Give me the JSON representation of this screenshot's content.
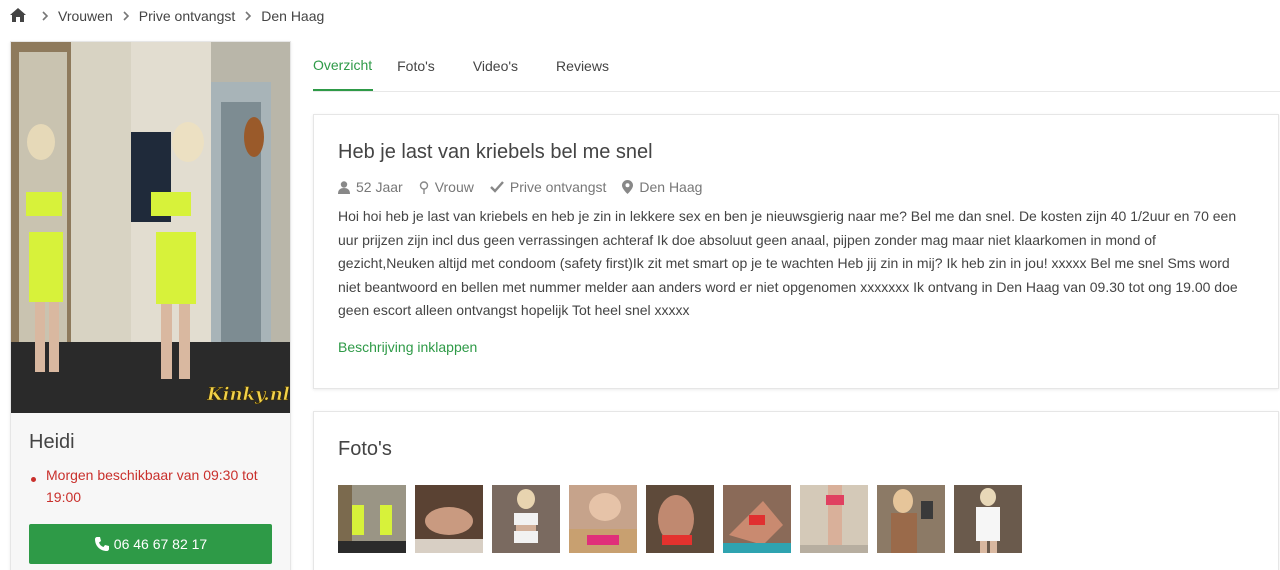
{
  "breadcrumb": {
    "home_icon": "home-icon",
    "items": [
      "Vrouwen",
      "Prive ontvangst",
      "Den Haag"
    ]
  },
  "profile": {
    "name": "Heidi",
    "availability": "Morgen beschikbaar van 09:30 tot 19:00",
    "phone": "06 46 67 82 17",
    "watermark": "Kinky.nl"
  },
  "tabs": [
    "Overzicht",
    "Foto's",
    "Video's",
    "Reviews"
  ],
  "listing": {
    "title": "Heb je last van kriebels bel me snel",
    "age": "52 Jaar",
    "gender": "Vrouw",
    "type": "Prive ontvangst",
    "city": "Den Haag",
    "description": "Hoi hoi heb je last van kriebels en heb je zin in lekkere sex en ben je nieuwsgierig naar me? Bel me dan snel. De kosten zijn 40 1/2uur en 70 een uur prijzen zijn incl dus geen verrassingen achteraf Ik doe absoluut geen anaal, pijpen zonder mag maar niet klaarkomen in mond of gezicht,Neuken altijd met condoom (safety first)Ik zit met smart op je te wachten Heb jij zin in mij? Ik heb zin in jou! xxxxx Bel me snel Sms word niet beantwoord en bellen met nummer melder aan anders word er niet opgenomen xxxxxxx Ik ontvang in Den Haag van 09.30 tot ong 19.00 doe geen escort alleen ontvangst hopelijk Tot heel snel xxxxx",
    "collapse_label": "Beschrijving inklappen"
  },
  "photos": {
    "title": "Foto's",
    "thumb_count": 9
  },
  "colors": {
    "accent": "#2e9a47",
    "alert": "#c9302c"
  }
}
